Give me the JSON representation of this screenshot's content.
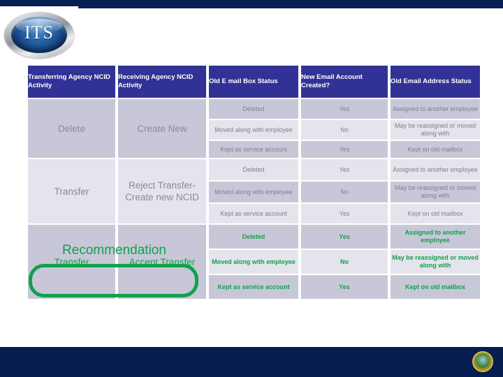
{
  "brand": {
    "logo_text": "ITS",
    "seal_name": "state-seal"
  },
  "table": {
    "headers": [
      "Transferring Agency NCID Activity",
      "Receiving Agency NCID Activity",
      "Old E mail Box Status",
      "New Email Account Created?",
      "Old Email Address Status"
    ],
    "row_groups": [
      {
        "transferring_activity": "Delete",
        "receiving_activity": "Create New",
        "rows": [
          {
            "old_mail_box_status": "Deleted",
            "new_email_account_created": "Yes",
            "old_email_address_status": "Assigned to another employee"
          },
          {
            "old_mail_box_status": "Moved along with employee",
            "new_email_account_created": "No",
            "old_email_address_status": "May be reassigned or moved along with"
          },
          {
            "old_mail_box_status": "Kept as service account",
            "new_email_account_created": "Yes",
            "old_email_address_status": "Kept on old mailbox"
          }
        ]
      },
      {
        "transferring_activity": "Transfer",
        "receiving_activity": "Reject Transfer-Create new NCID",
        "rows": [
          {
            "old_mail_box_status": "Deleted",
            "new_email_account_created": "Yes",
            "old_email_address_status": "Assigned to another employee"
          },
          {
            "old_mail_box_status": "Moved along with employee",
            "new_email_account_created": "No",
            "old_email_address_status": "May be reassigned or moved along with"
          },
          {
            "old_mail_box_status": "Kept as service account",
            "new_email_account_created": "Yes",
            "old_email_address_status": "Kept on old mailbox"
          }
        ]
      },
      {
        "transferring_activity": "Transfer",
        "receiving_activity": "Accept Transfer",
        "rows": [
          {
            "old_mail_box_status": "Deleted",
            "new_email_account_created": "Yes",
            "old_email_address_status": "Assigned to another employee"
          },
          {
            "old_mail_box_status": "Moved along with employee",
            "new_email_account_created": "No",
            "old_email_address_status": "May be reassigned or moved along with"
          },
          {
            "old_mail_box_status": "Kept as service account",
            "new_email_account_created": "Yes",
            "old_email_address_status": "Kept on old mailbox"
          }
        ]
      }
    ]
  },
  "annotation": {
    "recommendation_label": "Recommendation",
    "highlight_color": "#11a14a"
  },
  "colors": {
    "header_blue": "#323296",
    "navy_bar": "#061e51",
    "shade_a": "#c7c7d8",
    "shade_b": "#e4e4ec",
    "green": "#11a14a"
  }
}
